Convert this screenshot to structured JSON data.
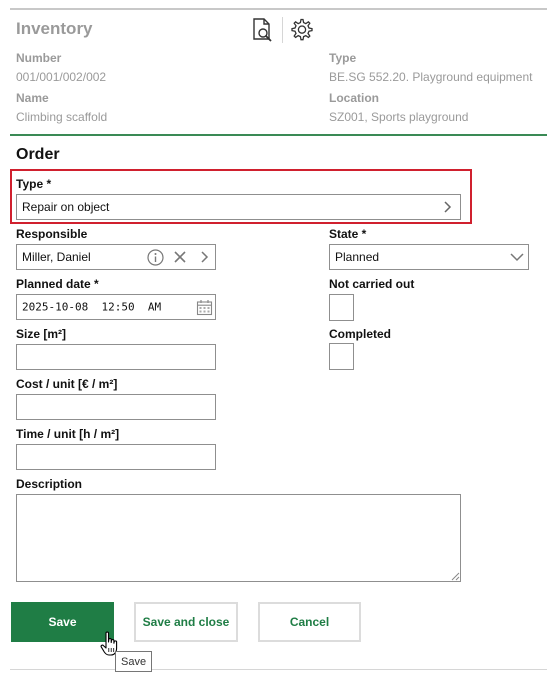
{
  "header": {
    "title": "Inventory",
    "preview_icon": "document-search-icon",
    "settings_icon": "gear-icon"
  },
  "inventory_info": {
    "number_label": "Number",
    "number_value": "001/001/002/002",
    "type_label": "Type",
    "type_value": "BE.SG 552.20. Playground equipment",
    "name_label": "Name",
    "name_value": "Climbing scaffold",
    "location_label": "Location",
    "location_value": "SZ001, Sports playground"
  },
  "order": {
    "section_title": "Order",
    "type_label": "Type *",
    "type_value": "Repair on object",
    "responsible_label": "Responsible",
    "responsible_value": "Miller, Daniel",
    "state_label": "State *",
    "state_value": "Planned",
    "planned_date_label": "Planned date *",
    "planned_date_value": "2025-10-08  12:50  AM",
    "not_carried_out_label": "Not carried out",
    "size_label": "Size [m²]",
    "size_value": "",
    "completed_label": "Completed",
    "cost_label": "Cost / unit [€ / m²]",
    "cost_value": "",
    "time_label": "Time / unit [h / m²]",
    "time_value": "",
    "description_label": "Description",
    "description_value": ""
  },
  "actions": {
    "save_label": "Save",
    "save_close_label": "Save and close",
    "cancel_label": "Cancel",
    "tooltip_text": "Save"
  },
  "colors": {
    "accent_green": "#1f7d45",
    "divider_green": "#3a8a55",
    "highlight_red": "#d0202e"
  }
}
